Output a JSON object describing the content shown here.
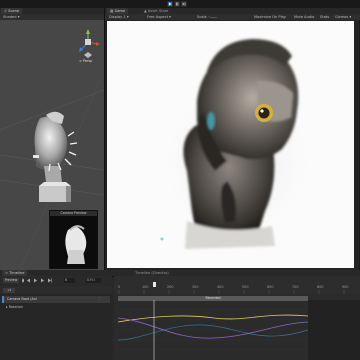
{
  "header": {
    "play_buttons": [
      "play-icon",
      "pause-icon",
      "step-icon"
    ]
  },
  "scene_panel": {
    "tab_label": "Scene",
    "toolbar_label": "Shaded",
    "gizmo_label": "< Persp",
    "camera_preview_label": "Camera Preview"
  },
  "tabs": {
    "game": "Game",
    "asset_store": "Asset Store"
  },
  "game_toolbar": {
    "display": "Display 1",
    "aspect": "Free Aspect",
    "scale": "Scale",
    "maximize": "Maximize On Play",
    "mute": "Mute Audio",
    "stats": "Stats",
    "gizmos": "Gizmos"
  },
  "timeline": {
    "tab_label": "Timeline",
    "tab2_label": "Timeline (Director)",
    "preview_label": "Preview",
    "frame_value": "0",
    "frame_field2": "8391",
    "track_label": "Camera Root (Ani",
    "property_label": "Rotation",
    "clip_label": "Recorded",
    "ruler_labels": [
      "0",
      "100",
      "200",
      "300",
      "400",
      "500",
      "600",
      "700",
      "800",
      "900"
    ],
    "curve_colors": {
      "x": "#e3c96b",
      "y": "#8d63cc",
      "z": "#4aa0d8"
    }
  }
}
